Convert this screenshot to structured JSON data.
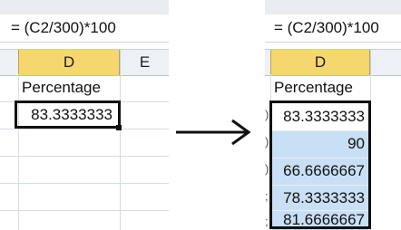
{
  "formula": "= (C2/300)*100",
  "left": {
    "columns": [
      "D",
      "E"
    ],
    "header_cell": "Percentage",
    "values": [
      "83.3333333"
    ]
  },
  "right": {
    "columns": [
      "D"
    ],
    "header_cell": "Percentage",
    "values": [
      "83.3333333",
      "90",
      "66.6666667",
      "78.3333333",
      "81.6666667"
    ]
  },
  "colors": {
    "selected_column_header": "#f6d66e",
    "selected_range_fill": "#c9dff5",
    "border": "#111111"
  },
  "icons": [
    "right-arrow-icon"
  ]
}
